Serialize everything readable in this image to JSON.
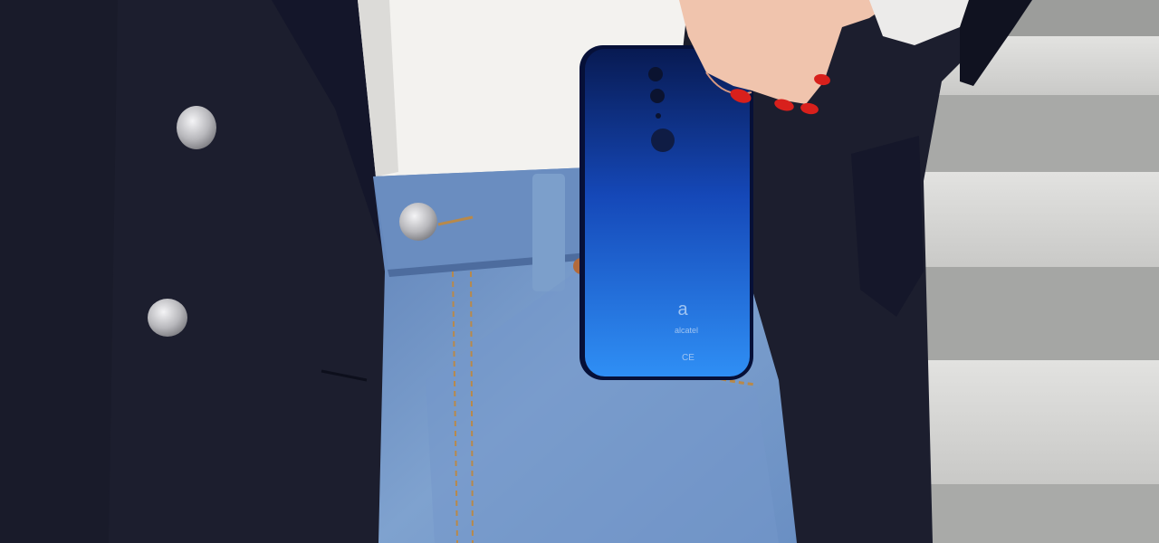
{
  "photo": {
    "colors": {
      "stairs_light": "#d9d9d7",
      "stairs_shadow": "#a9aaa8",
      "jacket": "#1c1e2e",
      "jacket_shadow": "#11131f",
      "shirt": "#f3f2ef",
      "denim": "#6f93c4",
      "denim_dark": "#4a6a9c",
      "phone_top": "#0a1f5e",
      "phone_bottom": "#2e8cf2",
      "skin": "#f0c4ad",
      "nail": "#d8201c",
      "button_metal": "#c9c9cc"
    },
    "phone_brand_mark": "alcatel",
    "phone_regulatory_mark": "CE"
  }
}
